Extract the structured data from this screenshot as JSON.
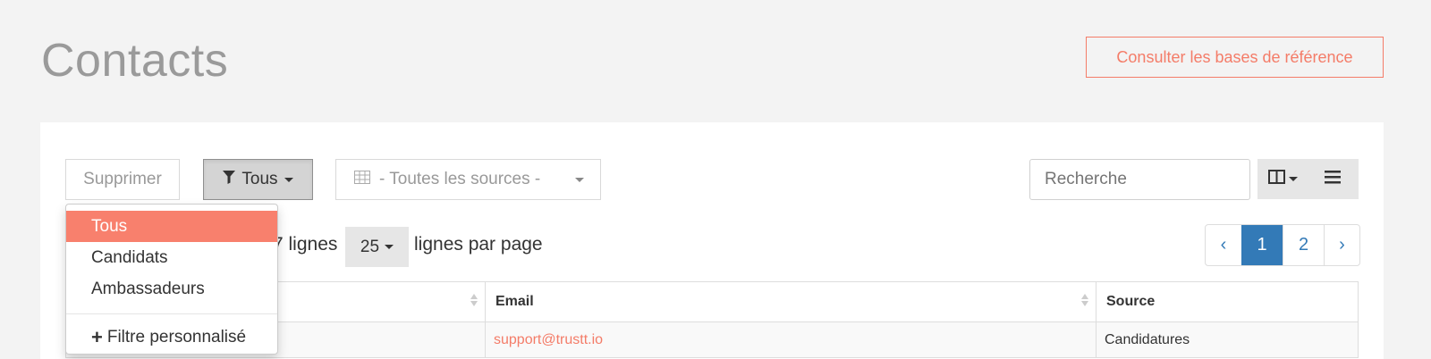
{
  "header": {
    "title": "Contacts",
    "ref_button_label": "Consulter les bases de référence"
  },
  "toolbar": {
    "delete_label": "Supprimer",
    "filter_label": "Tous",
    "source_label": "- Toutes les sources -",
    "search_placeholder": "Recherche"
  },
  "filter_menu": {
    "items": [
      {
        "label": "Tous",
        "active": true
      },
      {
        "label": "Candidats",
        "active": false
      },
      {
        "label": "Ambassadeurs",
        "active": false
      }
    ],
    "custom_label": "Filtre personnalisé"
  },
  "listing": {
    "rows_text": "7 lignes",
    "page_size": "25",
    "per_page_text": "lignes par page"
  },
  "pagination": {
    "prev": "‹",
    "pages": [
      "1",
      "2"
    ],
    "current": "1",
    "next": "›"
  },
  "table": {
    "columns": [
      "",
      "Email",
      "Source"
    ],
    "rows": [
      {
        "name": "",
        "email": "support@trustt.io",
        "source": "Candidatures"
      }
    ]
  },
  "colors": {
    "accent": "#f47c68",
    "active_item": "#f8806d",
    "pagination_active": "#337ab7"
  },
  "icons": {
    "filter": "filter-icon",
    "table": "table-icon",
    "columns": "columns-icon",
    "list": "list-icon",
    "plus": "plus-icon"
  }
}
